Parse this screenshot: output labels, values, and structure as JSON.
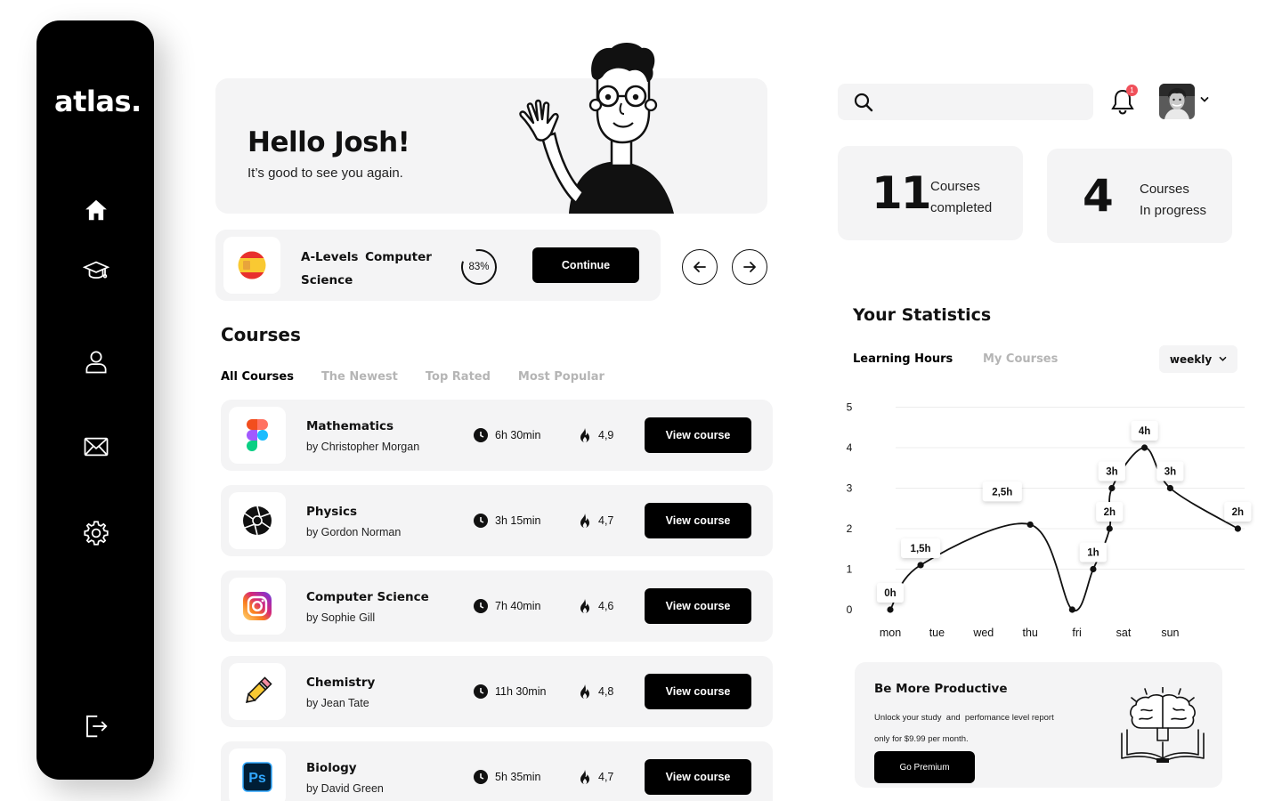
{
  "app": {
    "logo": "atlas."
  },
  "sidebar": {
    "items": [
      {
        "name": "home",
        "icon": "home-icon"
      },
      {
        "name": "courses",
        "icon": "graduation-cap-icon"
      },
      {
        "name": "profile",
        "icon": "user-icon"
      },
      {
        "name": "messages",
        "icon": "envelope-icon"
      },
      {
        "name": "settings",
        "icon": "gear-icon"
      }
    ],
    "logout_icon": "logout-icon"
  },
  "hero": {
    "title": "Hello Josh!",
    "subtitle": "It’s good to see you again."
  },
  "continue_card": {
    "title": "A-Levels Computer Science",
    "progress": 83,
    "progress_label": "83%",
    "button": "Continue"
  },
  "courses": {
    "title": "Courses",
    "tabs": [
      "All Courses",
      "The Newest",
      "Top Rated",
      "Most Popular"
    ],
    "active_tab": 0,
    "items": [
      {
        "name": "Mathematics",
        "author": "by Christopher Morgan",
        "duration": "6h 30min",
        "rating": "4,9",
        "button": "View course",
        "icon": "figma-icon"
      },
      {
        "name": "Physics",
        "author": "by Gordon Norman",
        "duration": "3h 15min",
        "rating": "4,7",
        "button": "View course",
        "icon": "aperture-icon"
      },
      {
        "name": "Computer Science",
        "author": "by Sophie Gill",
        "duration": "7h 40min",
        "rating": "4,6",
        "button": "View course",
        "icon": "instagram-icon"
      },
      {
        "name": "Chemistry",
        "author": "by Jean Tate",
        "duration": "11h 30min",
        "rating": "4,8",
        "button": "View course",
        "icon": "pencil-icon"
      },
      {
        "name": "Biology",
        "author": "by David Green",
        "duration": "5h 35min",
        "rating": "4,7",
        "button": "View course",
        "icon": "photoshop-icon"
      }
    ]
  },
  "header": {
    "search_placeholder": "",
    "notifications": "1"
  },
  "stats_cards": [
    {
      "number": "11",
      "line1": "Courses",
      "line2": "completed"
    },
    {
      "number": "4",
      "line1": "Courses",
      "line2": "In progress"
    }
  ],
  "statistics": {
    "title": "Your Statistics",
    "tabs": [
      "Learning Hours",
      "My Courses"
    ],
    "active_tab": 0,
    "period": "weekly"
  },
  "chart_data": {
    "type": "line",
    "x_labels": [
      "mon",
      "tue",
      "wed",
      "thu",
      "fri",
      "sat",
      "sun"
    ],
    "y_ticks": [
      0,
      1,
      2,
      3,
      4,
      5
    ],
    "ylim": [
      0,
      5
    ],
    "grid": true,
    "points": [
      {
        "x": 0,
        "y": 0,
        "label": "0h"
      },
      {
        "x": 0.65,
        "y": 1.1,
        "label": "1,5h"
      },
      {
        "x": 3,
        "y": 2.1,
        "label": ""
      },
      {
        "x": 3.9,
        "y": 0,
        "label": ""
      },
      {
        "x": 4.35,
        "y": 1,
        "label": "1h"
      },
      {
        "x": 4.7,
        "y": 2,
        "label": "2h"
      },
      {
        "x": 4.75,
        "y": 3,
        "label": "3h"
      },
      {
        "x": 5.45,
        "y": 4,
        "label": "4h"
      },
      {
        "x": 6.0,
        "y": 3,
        "label": "3h"
      },
      {
        "x": 7.45,
        "y": 2,
        "label": "2h"
      }
    ],
    "callouts": [
      {
        "x": 2.4,
        "y": 2.5,
        "label": "2,5h"
      }
    ]
  },
  "premium": {
    "title": "Be More Productive",
    "line1": "Unlock your study  and  perfomance level report",
    "line2": "only for $9.99 per month.",
    "button": "Go Premium"
  }
}
